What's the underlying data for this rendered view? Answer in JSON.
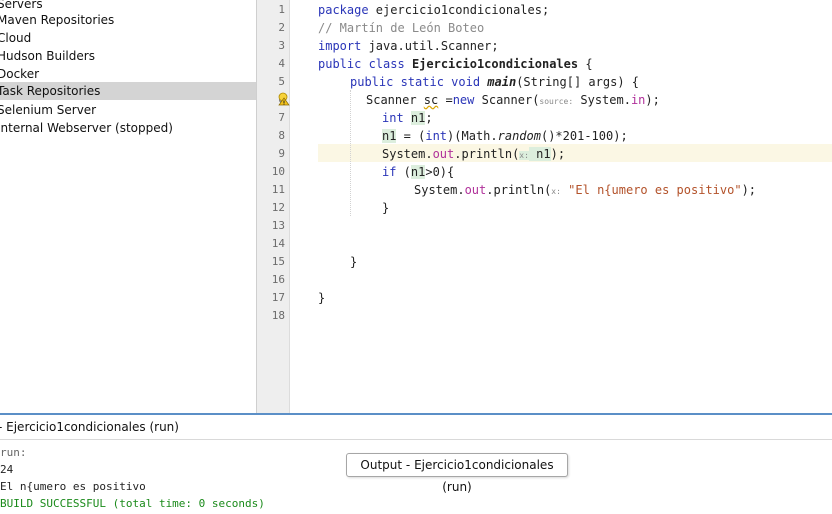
{
  "services": {
    "items": [
      {
        "label": "Servers",
        "selected": false
      },
      {
        "label": "Maven Repositories",
        "selected": false
      },
      {
        "label": "Cloud",
        "selected": false
      },
      {
        "label": "Hudson Builders",
        "selected": false
      },
      {
        "label": "Docker",
        "selected": false
      },
      {
        "label": "Task Repositories",
        "selected": true
      },
      {
        "label": "Selenium Server",
        "selected": false
      },
      {
        "label": "Internal Webserver (stopped)",
        "selected": false
      }
    ]
  },
  "editor": {
    "line_numbers": [
      "1",
      "2",
      "3",
      "4",
      "5",
      "6",
      "7",
      "8",
      "9",
      "10",
      "11",
      "12",
      "13",
      "14",
      "15",
      "16",
      "17",
      "18"
    ],
    "current_line": "9",
    "code": {
      "l1_kw": "package",
      "l1_rest": " ejercicio1condicionales;",
      "l2_comment": "// Martín de León Boteo",
      "l3_kw": "import",
      "l3_rest": " java.util.Scanner;",
      "l4_kw": "public class",
      "l4_name": "Ejercicio1condicionales",
      "l4_rest": " {",
      "l5_kw": "public static void",
      "l5_name": "main",
      "l5_rest": "(String[] args) {",
      "l6_a": "Scanner ",
      "l6_var": "sc",
      "l6_b": " =",
      "l6_kw": "new",
      "l6_c": " Scanner(",
      "l6_hint": "source:",
      "l6_d": " System.",
      "l6_fld": "in",
      "l6_e": ");",
      "l7_kw": "int",
      "l7_var": "n1",
      "l7_rest": ";",
      "l8_var": "n1",
      "l8_a": " = (",
      "l8_kw": "int",
      "l8_b": ")(Math.",
      "l8_m": "random",
      "l8_c": "()*201-100);",
      "l9_a": "System.",
      "l9_fld": "out",
      "l9_b": ".println(",
      "l9_hint": "x:",
      "l9_c": " n1",
      "l9_d": ");",
      "l10_kw": "if",
      "l10_a": " (",
      "l10_var": "n1",
      "l10_b": ">0){",
      "l11_a": "System.",
      "l11_fld": "out",
      "l11_b": ".println(",
      "l11_hint": "x:",
      "l11_str": "\"El n{umero es positivo\"",
      "l11_c": ");",
      "l12": "}",
      "l15": "}",
      "l17": "}"
    }
  },
  "output": {
    "tab_title": "- Ejercicio1condicionales (run)",
    "lines": [
      "run:",
      "24",
      "El n{umero es positivo",
      "BUILD SUCCESSFUL (total time: 0 seconds)"
    ],
    "tooltip": "Output - Ejercicio1condicionales (run)"
  },
  "colors": {
    "keyword": "#2a35b8",
    "comment": "#8a8a8a",
    "field": "#b0309a",
    "string": "#b3522a",
    "build_success": "#1a8a1a",
    "current_line": "#fbf7e4",
    "selection": "#d4d4d4"
  },
  "icons": {
    "warning": "warning-bulb-icon",
    "fold": "fold-collapse-icon"
  }
}
